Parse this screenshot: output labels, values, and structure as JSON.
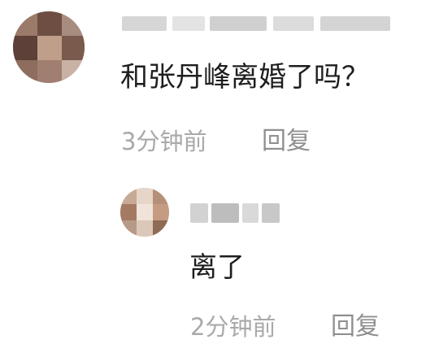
{
  "comment": {
    "avatar_icon": "pixelated-avatar-icon",
    "text": "和张丹峰离婚了吗？",
    "time": "3分钟前",
    "reply_label": "回复"
  },
  "reply_comment": {
    "avatar_icon": "pixelated-avatar-icon",
    "text": "离了",
    "time": "2分钟前",
    "reply_label": "回复"
  }
}
